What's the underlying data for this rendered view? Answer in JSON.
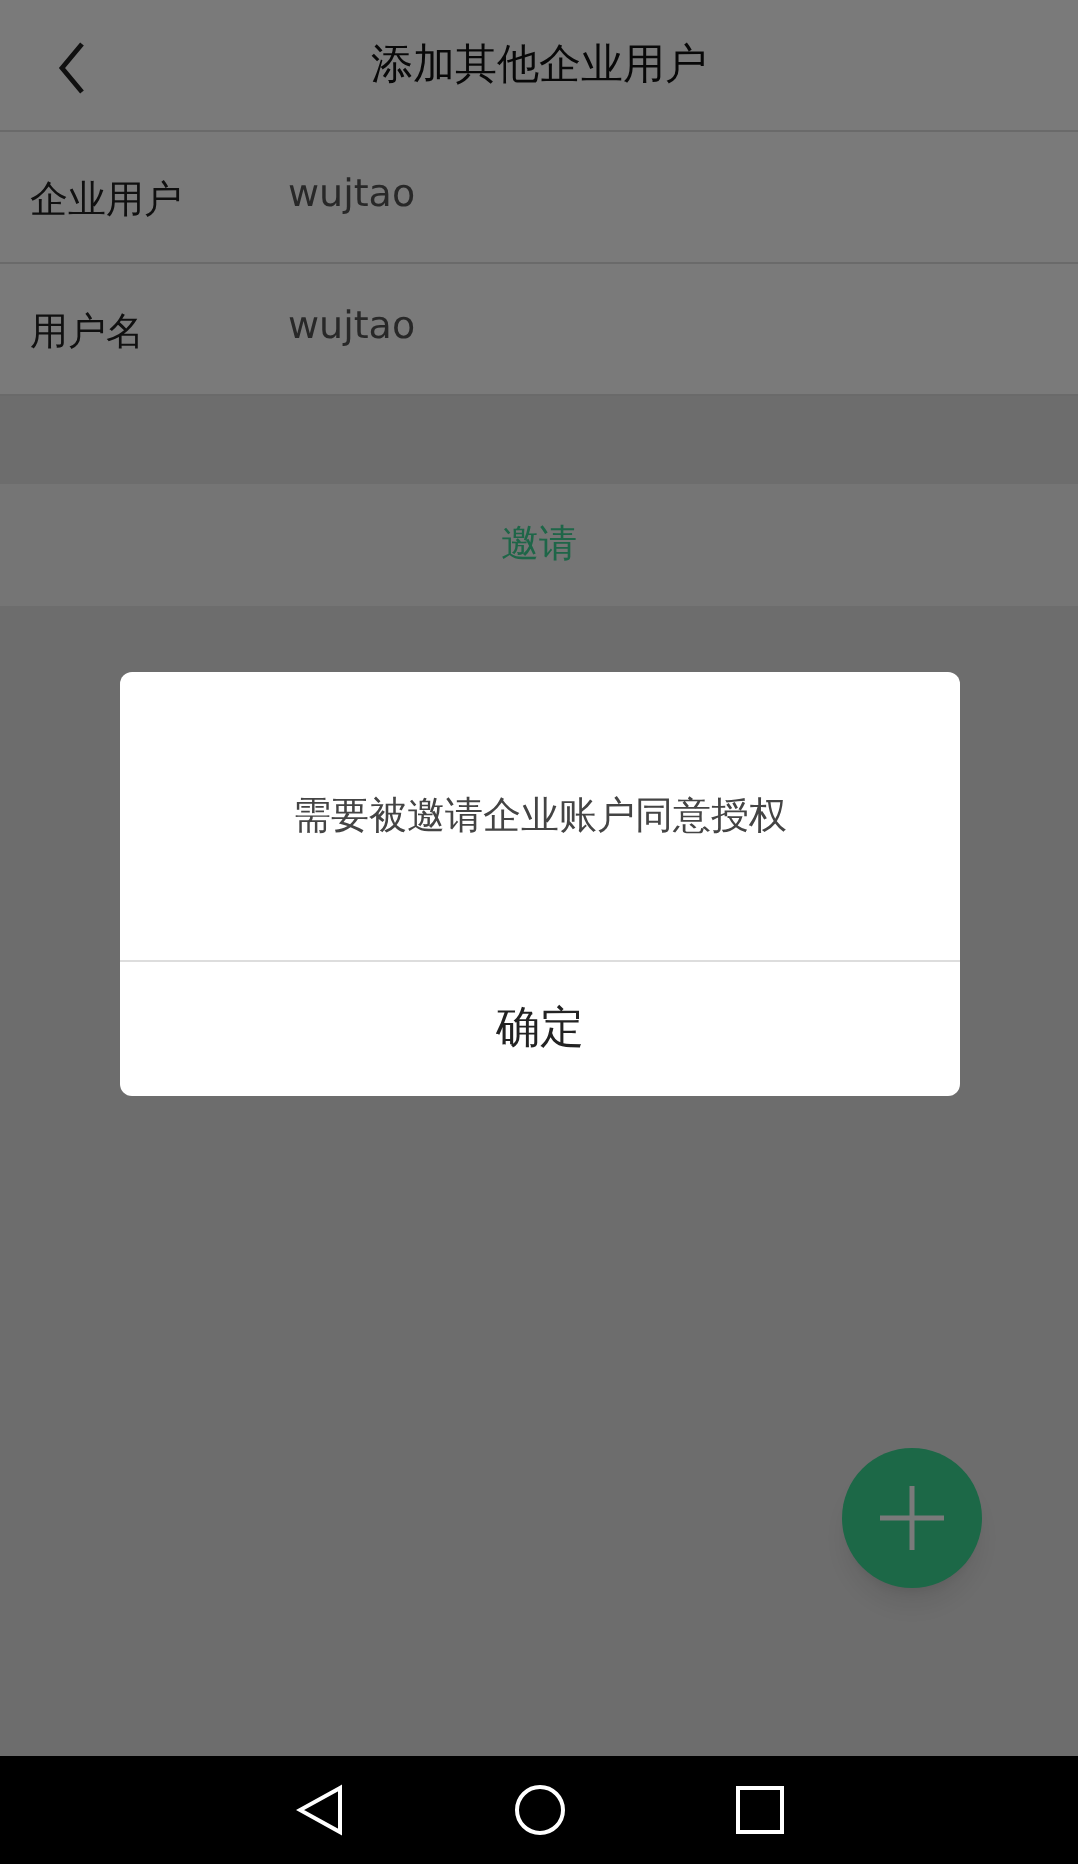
{
  "header": {
    "title": "添加其他企业用户"
  },
  "fields": [
    {
      "label": "企业用户",
      "value": "wujtao"
    },
    {
      "label": "用户名",
      "value": "wujtao"
    }
  ],
  "invite_button": {
    "label": "邀请"
  },
  "dialog": {
    "message": "需要被邀请企业账户同意授权",
    "confirm": "确定"
  }
}
